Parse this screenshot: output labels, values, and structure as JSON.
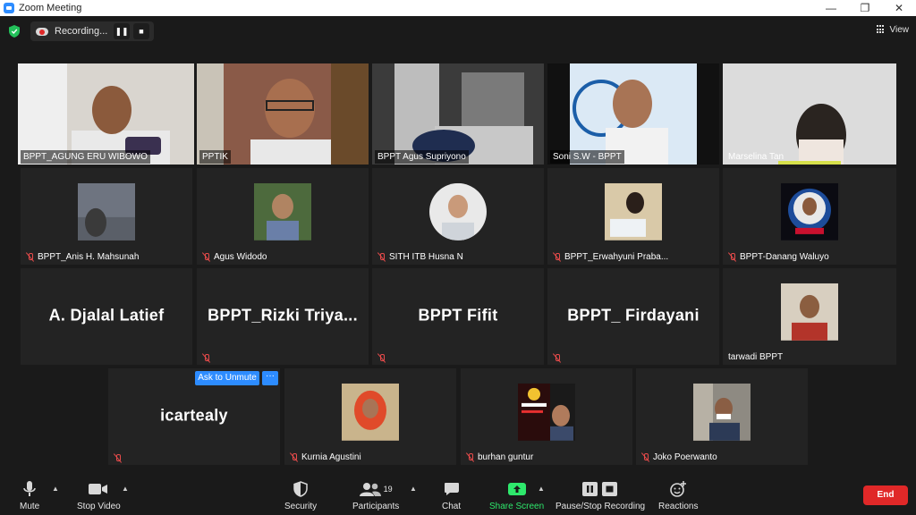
{
  "window": {
    "title": "Zoom Meeting",
    "controls": [
      "—",
      "❐",
      "✕"
    ]
  },
  "topbar": {
    "recording_label": "Recording...",
    "pause_glyph": "❚❚",
    "stop_glyph": "■",
    "view_label": "View"
  },
  "participants": [
    {
      "name": "BPPT_AGUNG ERU WIBOWO",
      "kind": "video",
      "muted": false
    },
    {
      "name": "PPTIK",
      "kind": "video",
      "muted": false
    },
    {
      "name": "BPPT Agus Supriyono",
      "kind": "video",
      "muted": false
    },
    {
      "name": "Soni S.W - BPPT",
      "kind": "video",
      "muted": false
    },
    {
      "name": "Marselina Tan",
      "kind": "video",
      "muted": false
    },
    {
      "name": "BPPT_Anis H. Mahsunah",
      "kind": "avatar",
      "muted": true
    },
    {
      "name": "Agus Widodo",
      "kind": "avatar",
      "muted": true
    },
    {
      "name": "SITH ITB Husna N",
      "kind": "avatar",
      "muted": true
    },
    {
      "name": "BPPT_Erwahyuni Praba...",
      "kind": "avatar",
      "muted": true
    },
    {
      "name": "BPPT-Danang Waluyo",
      "kind": "avatar",
      "muted": true
    },
    {
      "display": "A. Djalal Latief",
      "kind": "text",
      "muted": false
    },
    {
      "display": "BPPT_Rizki  Triya...",
      "kind": "text",
      "muted": true
    },
    {
      "display": "BPPT Fifit",
      "kind": "text",
      "muted": true
    },
    {
      "display": "BPPT_ Firdayani",
      "kind": "text",
      "muted": true
    },
    {
      "name": "tarwadi BPPT",
      "kind": "avatar",
      "muted": false
    },
    {
      "display": "icartealy",
      "kind": "text",
      "muted": true
    },
    {
      "name": "Kurnia Agustini",
      "kind": "avatar",
      "muted": true
    },
    {
      "name": "burhan guntur",
      "kind": "avatar",
      "muted": true
    },
    {
      "name": "Joko Poerwanto",
      "kind": "avatar",
      "muted": true
    }
  ],
  "hover_actions": {
    "ask_unmute": "Ask to Unmute",
    "more": "···"
  },
  "toolbar": {
    "mute": "Mute",
    "stop_video": "Stop Video",
    "security": "Security",
    "participants": "Participants",
    "participant_count": "19",
    "chat": "Chat",
    "share_screen": "Share Screen",
    "pause_stop_recording": "Pause/Stop Recording",
    "reactions": "Reactions",
    "end": "End"
  },
  "colors": {
    "active_speaker": "#c8d45a",
    "accent": "#2d8cff",
    "share": "#2ee86c",
    "end": "#e02828",
    "muted": "#e84b4b"
  }
}
